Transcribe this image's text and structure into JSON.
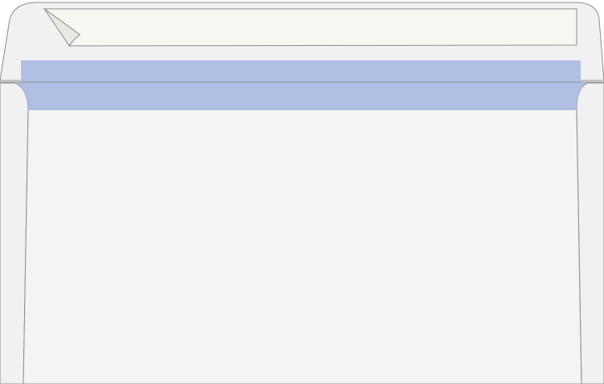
{
  "illustration": {
    "subject": "envelope-open-flap",
    "colors": {
      "background": "#ffffff",
      "envelope_body": "#f4f4f4",
      "side_flaps": "#f1f1f1",
      "outline": "#8c8c8c",
      "security_strip": "#b0bfe4",
      "security_strip_edge": "#98a8d2",
      "peel_strip": "#f8f6f1",
      "peel_corner_shadow": "#e9e7e2"
    }
  }
}
